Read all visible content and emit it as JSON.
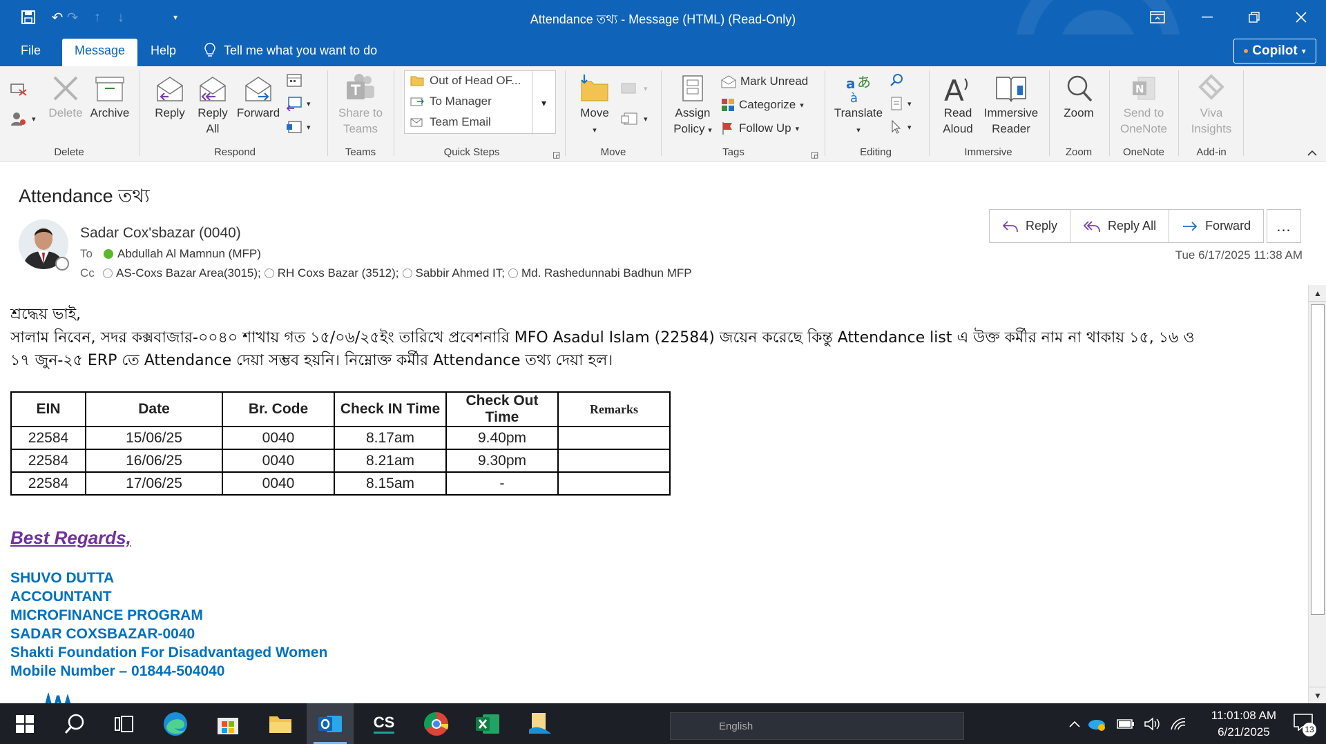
{
  "window": {
    "title": "Attendance তথ্য  -  Message (HTML) (Read-Only)"
  },
  "menu": {
    "tabs": [
      "File",
      "Message",
      "Help"
    ],
    "tell_me": "Tell me what you want to do",
    "copilot": "Copilot"
  },
  "ribbon": {
    "delete_group": {
      "delete": "Delete",
      "archive": "Archive",
      "label": "Delete"
    },
    "respond_group": {
      "reply": "Reply",
      "reply_all_1": "Reply",
      "reply_all_2": "All",
      "forward": "Forward",
      "label": "Respond"
    },
    "teams_group": {
      "share_1": "Share to",
      "share_2": "Teams",
      "label": "Teams"
    },
    "quick_steps": {
      "items": [
        "Out of Head OF...",
        "To Manager",
        "Team Email"
      ],
      "label": "Quick Steps"
    },
    "move_group": {
      "move": "Move",
      "label": "Move"
    },
    "tags_group": {
      "assign_1": "Assign",
      "assign_2": "Policy",
      "mark_unread": "Mark Unread",
      "categorize": "Categorize",
      "follow_up": "Follow Up",
      "label": "Tags"
    },
    "editing_group": {
      "translate": "Translate",
      "label": "Editing"
    },
    "immersive_group": {
      "read_1": "Read",
      "read_2": "Aloud",
      "reader_1": "Immersive",
      "reader_2": "Reader",
      "label": "Immersive"
    },
    "zoom_group": {
      "zoom": "Zoom",
      "label": "Zoom"
    },
    "onenote_group": {
      "send_1": "Send to",
      "send_2": "OneNote",
      "label": "OneNote"
    },
    "addin_group": {
      "viva_1": "Viva",
      "viva_2": "Insights",
      "label": "Add-in"
    }
  },
  "message": {
    "subject": "Attendance তথ্য",
    "from": "Sadar Cox'sbazar (0040)",
    "to_label": "To",
    "to": "Abdullah Al Mamnun (MFP)",
    "cc_label": "Cc",
    "cc": [
      "AS-Coxs Bazar Area(3015);",
      "RH Coxs Bazar (3512);",
      "Sabbir Ahmed IT;",
      "Md. Rashedunnabi Badhun MFP"
    ],
    "date": "Tue 6/17/2025 11:38 AM",
    "actions": {
      "reply": "Reply",
      "reply_all": "Reply All",
      "forward": "Forward",
      "more": "..."
    }
  },
  "body": {
    "greeting": "শ্রদ্ধেয় ভাই,",
    "line1": "সালাম নিবেন, সদর কক্সবাজার-০০৪০ শাখায় গত ১৫/০৬/২৫ইং তারিখে প্রবেশনারি MFO Asadul Islam (22584) জয়েন করেছে কিন্তু Attendance list এ উক্ত কর্মীর নাম না থাকায় ১৫, ১৬ ও",
    "line2": "১৭ জুন-২৫ ERP তে Attendance দেয়া সম্ভব হয়নি। নিম্নোক্ত কর্মীর Attendance তথ্য দেয়া হল।",
    "table": {
      "headers": [
        "EIN",
        "Date",
        "Br. Code",
        "Check IN Time",
        "Check Out Time",
        "Remarks"
      ],
      "rows": [
        [
          "22584",
          "15/06/25",
          "0040",
          "8.17am",
          "9.40pm",
          ""
        ],
        [
          "22584",
          "16/06/25",
          "0040",
          "8.21am",
          "9.30pm",
          ""
        ],
        [
          "22584",
          "17/06/25",
          "0040",
          "8.15am",
          "-",
          ""
        ]
      ]
    },
    "regards": "Best Regards,",
    "signature": [
      "SHUVO DUTTA",
      "ACCOUNTANT",
      "MICROFINANCE PROGRAM",
      "SADAR COXSBAZAR-0040",
      "Shakti Foundation For Disadvantaged Women",
      "Mobile Number – 01844-504040"
    ]
  },
  "taskbar": {
    "language": "English",
    "time": "11:01:08 AM",
    "date": "6/21/2025",
    "notifications": "13",
    "apps": [
      "start-icon",
      "search-icon",
      "task-view-icon",
      "edge-icon",
      "store-icon",
      "file-explorer-icon",
      "outlook-icon",
      "cs-icon",
      "chrome-icon",
      "excel-icon",
      "files-icon"
    ]
  },
  "colors": {
    "titlebar": "#0f63b8",
    "signature": "#0070c0",
    "regards": "#7030a0"
  }
}
